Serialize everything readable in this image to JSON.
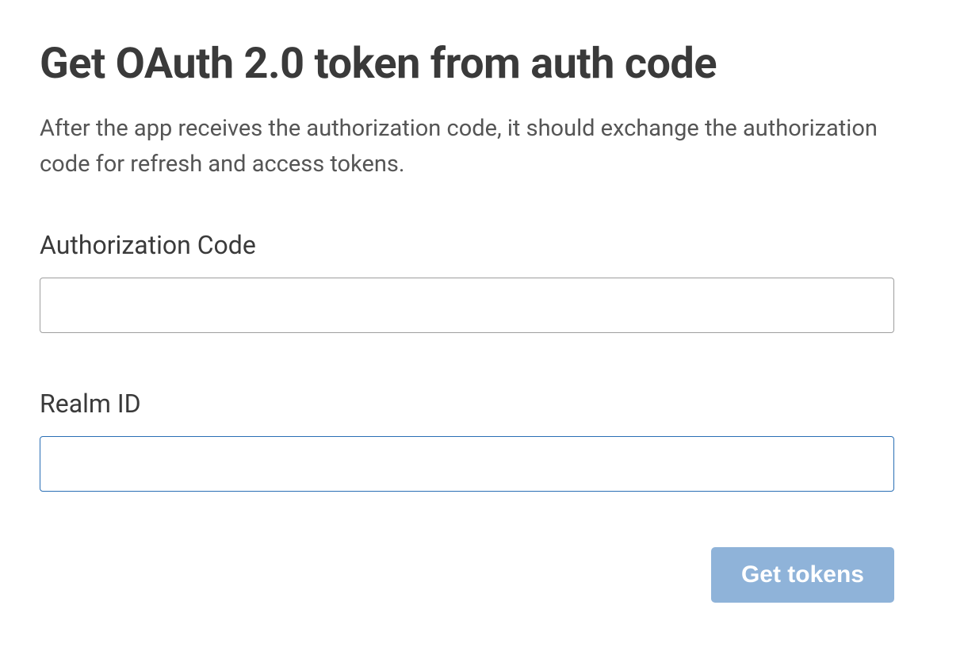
{
  "page": {
    "title": "Get OAuth 2.0 token from auth code",
    "description": "After the app receives the authorization code, it should exchange the authorization code for refresh and access tokens."
  },
  "fields": {
    "authCode": {
      "label": "Authorization Code",
      "value": ""
    },
    "realmId": {
      "label": "Realm ID",
      "value": ""
    }
  },
  "actions": {
    "getTokens": "Get tokens"
  }
}
